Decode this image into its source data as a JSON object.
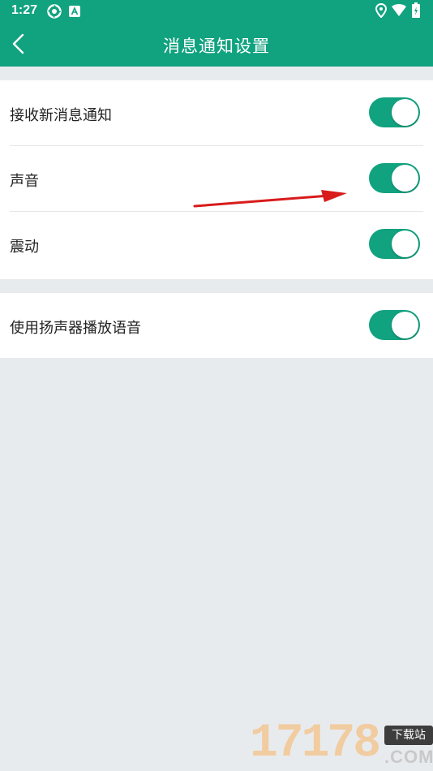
{
  "status_bar": {
    "time": "1:27",
    "icons": [
      "aperture-icon",
      "a-badge-icon",
      "location-icon",
      "wifi-icon",
      "battery-charging-icon"
    ]
  },
  "app_bar": {
    "title": "消息通知设置",
    "back_icon": "chevron-left-icon"
  },
  "settings": [
    {
      "label": "接收新消息通知",
      "enabled": true
    },
    {
      "label": "声音",
      "enabled": true
    },
    {
      "label": "震动",
      "enabled": true
    }
  ],
  "settings_group2": [
    {
      "label": "使用扬声器播放语音",
      "enabled": true
    }
  ],
  "colors": {
    "primary": "#11a27f",
    "background": "#e8ebee",
    "annotation_arrow": "#d81b1b"
  },
  "watermark": {
    "digits": "17178",
    "tag": "下载站",
    "domain": ".COM"
  }
}
